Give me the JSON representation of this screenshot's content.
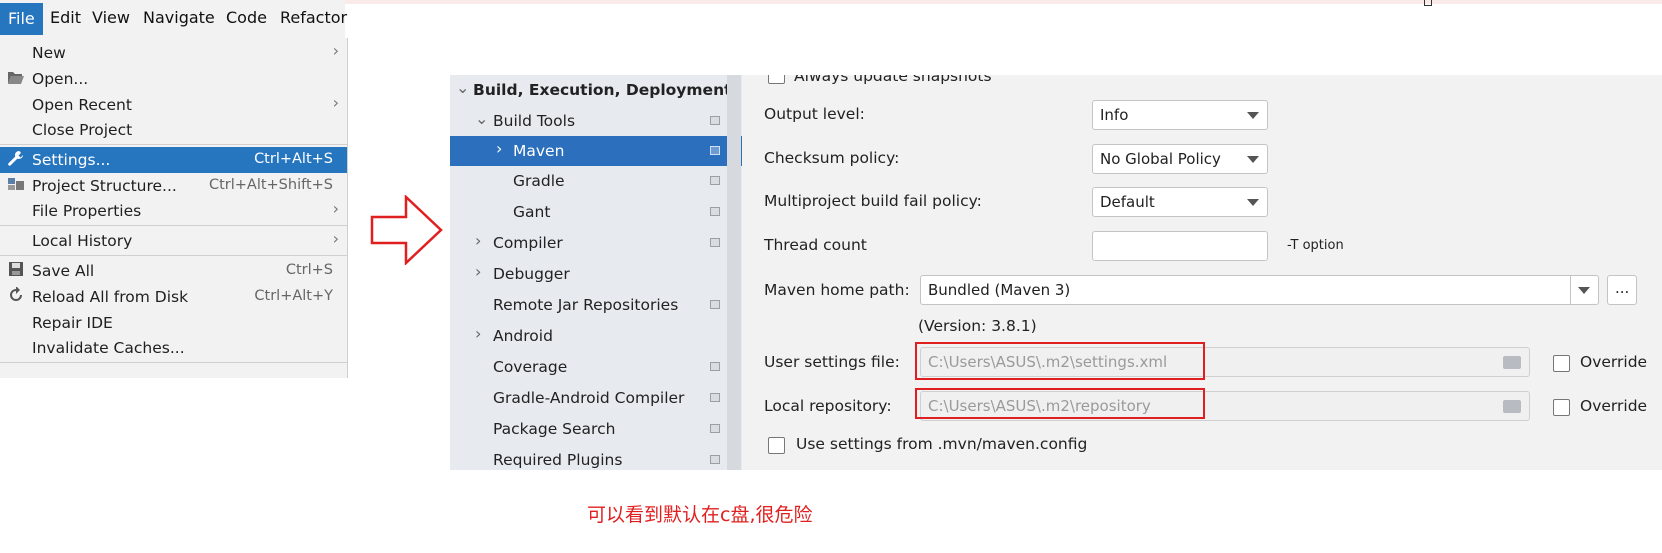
{
  "menubar": {
    "items": [
      "File",
      "Edit",
      "View",
      "Navigate",
      "Code",
      "Refactor"
    ]
  },
  "file_menu": {
    "items": [
      {
        "label": "New",
        "shortcut": "",
        "submenu": true,
        "icon": ""
      },
      {
        "label": "Open...",
        "shortcut": "",
        "submenu": false,
        "icon": "folder-open-icon"
      },
      {
        "label": "Open Recent",
        "shortcut": "",
        "submenu": true,
        "icon": ""
      },
      {
        "label": "Close Project",
        "shortcut": "",
        "submenu": false,
        "icon": ""
      },
      {
        "label": "Settings...",
        "shortcut": "Ctrl+Alt+S",
        "submenu": false,
        "icon": "wrench-icon",
        "selected": true
      },
      {
        "label": "Project Structure...",
        "shortcut": "Ctrl+Alt+Shift+S",
        "submenu": false,
        "icon": "project-structure-icon"
      },
      {
        "label": "File Properties",
        "shortcut": "",
        "submenu": true,
        "icon": ""
      },
      {
        "label": "Local History",
        "shortcut": "",
        "submenu": true,
        "icon": ""
      },
      {
        "label": "Save All",
        "shortcut": "Ctrl+S",
        "submenu": false,
        "icon": "save-icon"
      },
      {
        "label": "Reload All from Disk",
        "shortcut": "Ctrl+Alt+Y",
        "submenu": false,
        "icon": "reload-icon"
      },
      {
        "label": "Repair IDE",
        "shortcut": "",
        "submenu": false,
        "icon": ""
      },
      {
        "label": "Invalidate Caches...",
        "shortcut": "",
        "submenu": false,
        "icon": ""
      }
    ]
  },
  "tree": {
    "nodes": [
      {
        "label": "Build, Execution, Deployment",
        "expanded": true,
        "bold": true
      },
      {
        "label": "Build Tools",
        "expanded": true
      },
      {
        "label": "Maven",
        "selected": true
      },
      {
        "label": "Gradle"
      },
      {
        "label": "Gant"
      },
      {
        "label": "Compiler"
      },
      {
        "label": "Debugger"
      },
      {
        "label": "Remote Jar Repositories"
      },
      {
        "label": "Android"
      },
      {
        "label": "Coverage"
      },
      {
        "label": "Gradle-Android Compiler"
      },
      {
        "label": "Package Search"
      },
      {
        "label": "Required Plugins"
      }
    ]
  },
  "maven": {
    "always_update_snapshots": "Always update snapshots",
    "output_level_label": "Output level:",
    "output_level_value": "Info",
    "checksum_label": "Checksum policy:",
    "checksum_value": "No Global Policy",
    "multiproject_label": "Multiproject build fail policy:",
    "multiproject_value": "Default",
    "thread_count_label": "Thread count",
    "thread_count_value": "",
    "thread_option": "-T option",
    "home_label": "Maven home path:",
    "home_value": "Bundled (Maven 3)",
    "browse_label": "...",
    "version": "(Version: 3.8.1)",
    "user_settings_label": "User settings file:",
    "user_settings_value": "C:\\Users\\ASUS\\.m2\\settings.xml",
    "override_label": "Override",
    "local_repo_label": "Local repository:",
    "local_repo_value": "C:\\Users\\ASUS\\.m2\\repository",
    "use_mvn_config": "Use settings from .mvn/maven.config"
  },
  "annotation": "可以看到默认在c盘,很危险",
  "colors": {
    "accent": "#2675bf",
    "annotation": "#e02020"
  }
}
